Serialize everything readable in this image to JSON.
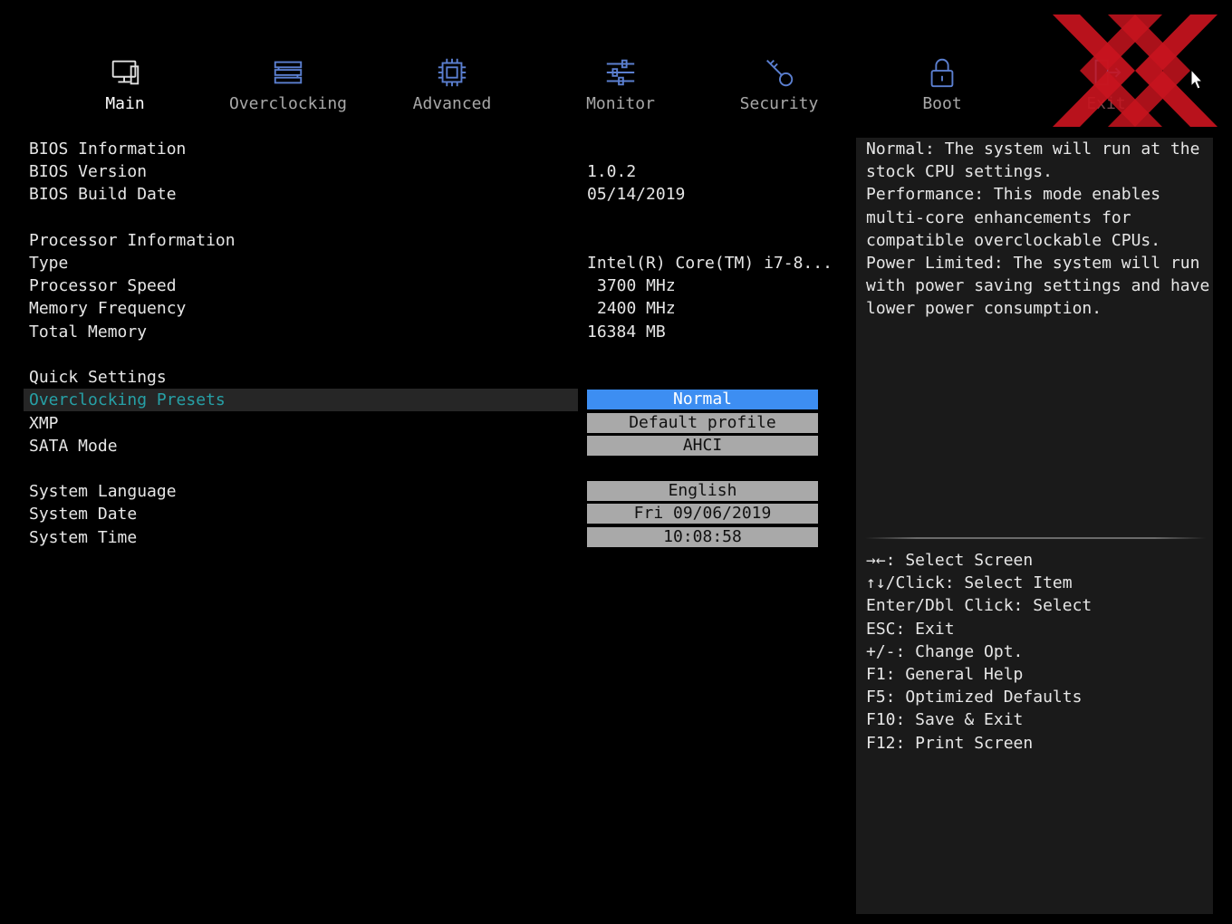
{
  "nav": {
    "tabs": [
      {
        "label": "Main",
        "icon": "monitor-pc-icon",
        "active": true
      },
      {
        "label": "Overclocking",
        "icon": "memory-stack-icon",
        "active": false
      },
      {
        "label": "Advanced",
        "icon": "chip-icon",
        "active": false
      },
      {
        "label": "Monitor",
        "icon": "sliders-icon",
        "active": false
      },
      {
        "label": "Security",
        "icon": "key-icon",
        "active": false
      },
      {
        "label": "Boot",
        "icon": "lock-icon",
        "active": false
      },
      {
        "label": "Exit",
        "icon": "exit-door-icon",
        "active": false
      }
    ]
  },
  "bios": {
    "header": "BIOS Information",
    "version_label": "BIOS Version",
    "version_value": "1.0.2",
    "build_label": "BIOS Build Date",
    "build_value": "05/14/2019"
  },
  "processor": {
    "header": "Processor Information",
    "type_label": "Type",
    "type_value": "Intel(R) Core(TM) i7-8...",
    "speed_label": "Processor Speed",
    "speed_value": "3700 MHz",
    "memfreq_label": "Memory Frequency",
    "memfreq_value": "2400 MHz",
    "totalmem_label": "Total Memory",
    "totalmem_value": "16384 MB"
  },
  "quick": {
    "header": "Quick Settings",
    "oc_label": "Overclocking Presets",
    "oc_value": "Normal",
    "xmp_label": "XMP",
    "xmp_value": "Default profile",
    "sata_label": "SATA Mode",
    "sata_value": "AHCI"
  },
  "system": {
    "lang_label": "System Language",
    "lang_value": "English",
    "date_label": "System Date",
    "date_value": "Fri 09/06/2019",
    "time_label": "System Time",
    "time_value": "10:08:58"
  },
  "help": {
    "lines": [
      "Normal: The system will run at the",
      "stock CPU settings.",
      "Performance: This mode enables",
      "multi-core enhancements for",
      "compatible overclockable CPUs.",
      "Power Limited: The system will run",
      "with power saving settings and have",
      "lower power consumption."
    ]
  },
  "keys": {
    "lines": [
      "→←: Select Screen",
      "↑↓/Click: Select Item",
      "Enter/Dbl Click: Select",
      "ESC: Exit",
      "+/-: Change Opt.",
      "F1: General Help",
      "F5: Optimized Defaults",
      "F10: Save & Exit",
      "F12: Print Screen"
    ]
  },
  "colors": {
    "background": "#000000",
    "selected_text": "#26a0a6",
    "active_option": "#3d8ef2",
    "option_bg": "#a9a9a9",
    "icon_blue": "#5b7fd0",
    "logo_red": "#c8141e"
  },
  "logo": {
    "icon": "xx-logo-icon"
  }
}
